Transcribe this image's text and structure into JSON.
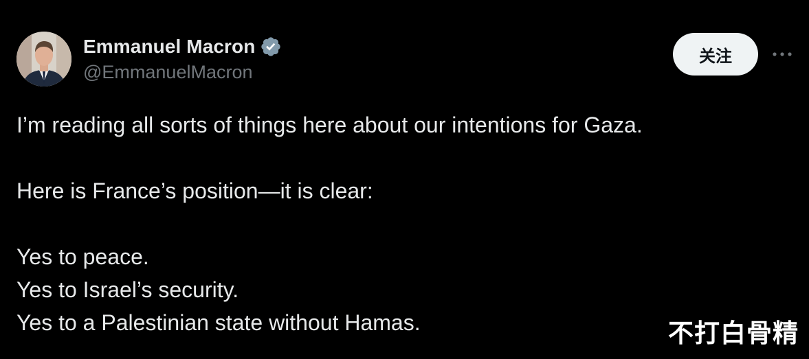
{
  "author": {
    "display_name": "Emmanuel Macron",
    "handle": "@EmmanuelMacron",
    "verified_icon": "verified-badge-icon",
    "verified_color": "#829aab"
  },
  "actions": {
    "follow_label": "关注",
    "more_icon": "more-horizontal-icon"
  },
  "tweet": {
    "lines": [
      "I’m reading all sorts of things here about our intentions for Gaza.",
      "",
      "Here is France’s position—it is clear:",
      "",
      "Yes to peace.",
      "Yes to Israel’s security.",
      "Yes to a Palestinian state without Hamas."
    ]
  },
  "watermark": {
    "text": "不打白骨精"
  },
  "colors": {
    "background": "#000000",
    "primary_text": "#e7e9ea",
    "secondary_text": "#71767b",
    "follow_button_bg": "#eff3f4",
    "follow_button_text": "#0f1419"
  }
}
